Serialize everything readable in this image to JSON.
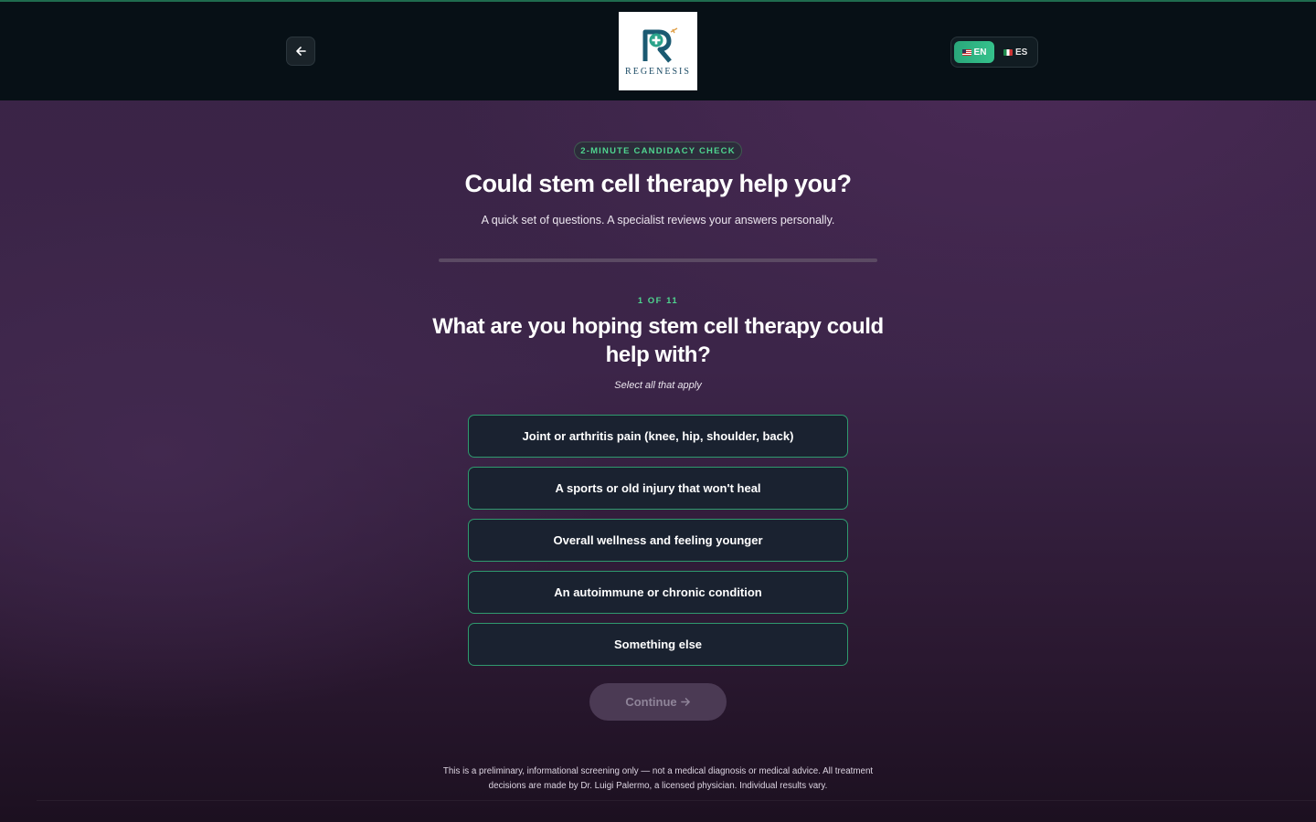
{
  "header": {
    "back_icon": "arrow-left-icon",
    "logo_text": "REGENESIS",
    "languages": [
      {
        "code": "EN",
        "flag": "us-flag",
        "active": true
      },
      {
        "code": "ES",
        "flag": "mx-flag",
        "active": false
      }
    ]
  },
  "intro": {
    "badge": "2-MINUTE CANDIDACY CHECK",
    "title": "Could stem cell therapy help you?",
    "subtitle": "A quick set of questions. A specialist reviews your answers personally."
  },
  "progress": {
    "fraction": 0
  },
  "question": {
    "step": "1 OF 11",
    "text": "What are you hoping stem cell therapy could help with?",
    "hint": "Select all that apply",
    "options": [
      "Joint or arthritis pain (knee, hip, shoulder, back)",
      "A sports or old injury that won't heal",
      "Overall wellness and feeling younger",
      "An autoimmune or chronic condition",
      "Something else"
    ]
  },
  "continue": {
    "label": "Continue",
    "icon": "arrow-right-icon",
    "disabled": true
  },
  "disclaimer": "This is a preliminary, informational screening only — not a medical diagnosis or medical advice. All treatment decisions are made by Dr. Luigi Palermo, a licensed physician. Individual results vary.",
  "colors": {
    "accent": "#39c184",
    "header_bg": "#071016",
    "option_bg": "#1a2230",
    "option_border": "#2f9a6e"
  }
}
